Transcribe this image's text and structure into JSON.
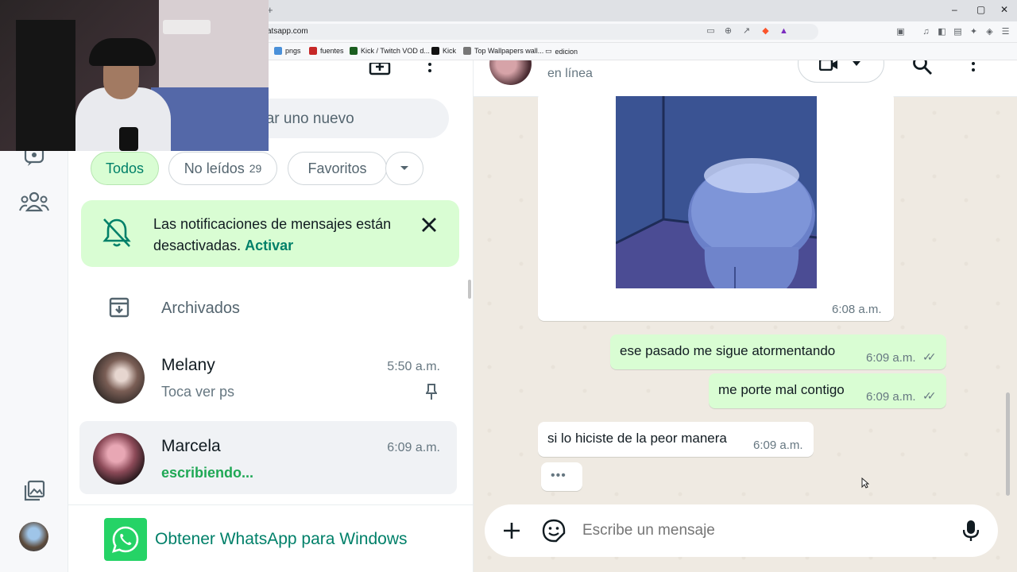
{
  "browser": {
    "new_tab_symbol": "+",
    "url": "atsapp.com",
    "window_controls": [
      "–",
      "▢",
      "✕"
    ],
    "bookmarks": [
      {
        "label": "pngs",
        "color": "#4a90d9"
      },
      {
        "label": "fuentes",
        "color": "#c62828"
      },
      {
        "label": "Kick / Twitch VOD d...",
        "color": "#1b5e20"
      },
      {
        "label": "Kick",
        "color": "#111111"
      },
      {
        "label": "Top Wallpapers wall...",
        "color": "#777777"
      },
      {
        "label": "edicion",
        "color": "#5f6368"
      }
    ]
  },
  "list": {
    "search_placeholder": "iniciar uno nuevo",
    "filters": [
      {
        "label": "Todos",
        "count": ""
      },
      {
        "label": "No leídos",
        "count": "29"
      },
      {
        "label": "Favoritos",
        "count": ""
      }
    ],
    "notification": {
      "text": "Las notificaciones de mensajes están desactivadas.",
      "link": "Activar"
    },
    "archived_label": "Archivados",
    "chats": [
      {
        "name": "Melany",
        "time": "5:50 a.m.",
        "preview": "Toca ver ps",
        "pinned": true
      },
      {
        "name": "Marcela",
        "time": "6:09 a.m.",
        "preview": "escribiendo...",
        "typing": true
      }
    ],
    "get_app_label": "Obtener WhatsApp para Windows"
  },
  "conversation": {
    "status": "en línea",
    "messages": [
      {
        "direction": "in",
        "type": "sticker",
        "time": "6:08 a.m."
      },
      {
        "direction": "out",
        "text": "ese pasado me sigue atormentando",
        "time": "6:09 a.m."
      },
      {
        "direction": "out",
        "text": "me porte mal contigo",
        "time": "6:09 a.m."
      },
      {
        "direction": "in",
        "text": "si lo hiciste de la peor manera",
        "time": "6:09 a.m."
      }
    ],
    "typing_indicator": "•••",
    "composer_placeholder": "Escribe un mensaje"
  },
  "colors": {
    "accent": "#008069",
    "outgoing_bubble": "#d9fdd3",
    "chat_background": "#efeae2",
    "whatsapp_green": "#25d366"
  }
}
